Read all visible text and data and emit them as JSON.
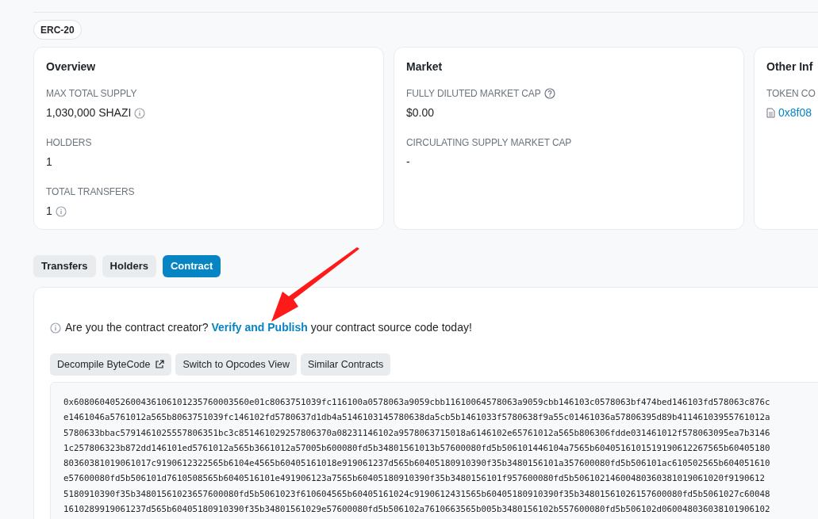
{
  "badge": "ERC-20",
  "cards": [
    {
      "title": "Overview",
      "fields": [
        {
          "label": "MAX TOTAL SUPPLY",
          "value": "1,030,000 SHAZI",
          "kind": "text",
          "help": false,
          "info": true
        },
        {
          "label": "HOLDERS",
          "value": "1",
          "kind": "text",
          "help": false,
          "info": false
        },
        {
          "label": "TOTAL TRANSFERS",
          "value": "1",
          "kind": "text",
          "help": false,
          "info": true
        }
      ]
    },
    {
      "title": "Market",
      "fields": [
        {
          "label": "FULLY DILUTED MARKET CAP",
          "value": "$0.00",
          "kind": "text",
          "help": true,
          "info": false
        },
        {
          "label": "CIRCULATING SUPPLY MARKET CAP",
          "value": "-",
          "kind": "text",
          "help": false,
          "info": false
        }
      ]
    },
    {
      "title": "Other Inf",
      "fields": [
        {
          "label": "TOKEN CO",
          "value": "0x8f08",
          "kind": "link",
          "help": false,
          "info": false
        }
      ]
    }
  ],
  "tabs": [
    {
      "label": "Transfers",
      "selected": false
    },
    {
      "label": "Holders",
      "selected": false
    },
    {
      "label": "Contract",
      "selected": true
    }
  ],
  "notice": {
    "before": "Are you the contract creator?",
    "link": "Verify and Publish",
    "after": "your contract source code today!"
  },
  "buttons": [
    {
      "label": "Decompile ByteCode",
      "external": true
    },
    {
      "label": "Switch to Opcodes View",
      "external": false
    },
    {
      "label": "Similar Contracts",
      "external": false
    }
  ],
  "bytecode_lines": [
    "0x6080604052600436106101235760003560e01c8063751039fc116100a0578063a9059cbb11610064578063a9059cbb146103c0578063bf474bed146103fd578063c876c",
    "e1461046a5761012a565b8063751039fc146102fd5780637d1db4a5146103145780638da5cb5b1461033f5780638f9a55c01461036a57806395d89b41146103955761012a",
    "5780633bbac5791461025557806351bc3c851461029257806370a08231146102a9578063715018a6146102e65761012a565b806306fdde031461012f578063095ea7b3146",
    "1c257806323b872dd146101ed5761012a565b3661012a57005b600080fd5b34801561013b57600080fd5b506101446104a7565b6040516101519190612267565b60405180",
    "80360381019061017c9190612322565b6104e4565b60405161018e919061237d565b60405180910390f35b3480156101a357600080fd5b506101ac610502565b604051610",
    "e57600080fd5b506101d7610508565b6040516101e491906123a7565b60405180910390f35b3480156101f957600080fd5b50610214600480360381019061020f9190612",
    "5180910390f35b34801561023657600080fd5b5061023f610604565b60405161024c9190612431565b60405180910390f35b34801561026157600080fd5b5061027c60048",
    "1610289919061237d565b60405180910390f35b34801561029e57600080fd5b506102a7610663565b005b3480156102b557600080fd5b506102d060048036038101906102"
  ]
}
